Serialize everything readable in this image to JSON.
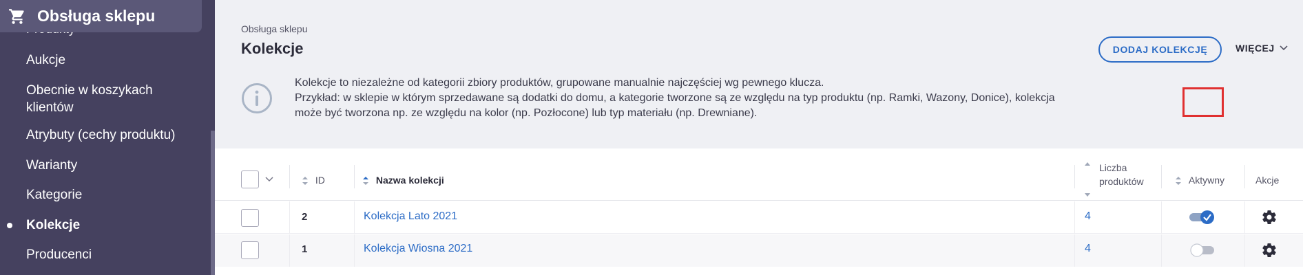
{
  "sidebar": {
    "section_title": "Obsługa sklepu",
    "cut_item": "Produkty",
    "items": [
      {
        "label": "Aukcje",
        "active": false
      },
      {
        "label": "Obecnie w koszykach klientów",
        "active": false
      },
      {
        "label": "Atrybuty (cechy produktu)",
        "active": false
      },
      {
        "label": "Warianty",
        "active": false
      },
      {
        "label": "Kategorie",
        "active": false
      },
      {
        "label": "Kolekcje",
        "active": true
      },
      {
        "label": "Producenci",
        "active": false
      }
    ]
  },
  "header": {
    "breadcrumb": "Obsługa sklepu",
    "title": "Kolekcje",
    "add_button": "DODAJ KOLEKCJĘ",
    "more_button": "WIĘCEJ"
  },
  "info": {
    "line1": "Kolekcje to niezależne od kategorii zbiory produktów, grupowane manualnie najczęściej wg pewnego klucza.",
    "line2": "Przykład: w sklepie w którym sprzedawane są dodatki do domu, a kategorie tworzone są ze względu na typ produktu (np. Ramki, Wazony, Donice), kolekcja",
    "line3": "może być tworzona np. ze względu na kolor (np. Pozłocone) lub typ materiału (np. Drewniane)."
  },
  "table": {
    "columns": {
      "id": "ID",
      "name": "Nazwa kolekcji",
      "count_line1": "Liczba",
      "count_line2": "produktów",
      "active": "Aktywny",
      "actions": "Akcje"
    },
    "rows": [
      {
        "id": "2",
        "name": "Kolekcja Lato 2021",
        "count": "4",
        "active": true
      },
      {
        "id": "1",
        "name": "Kolekcja Wiosna 2021",
        "count": "4",
        "active": false
      }
    ]
  },
  "colors": {
    "sidebar_bg": "#45415f",
    "accent": "#2c6cc6",
    "highlight": "#e03030"
  }
}
